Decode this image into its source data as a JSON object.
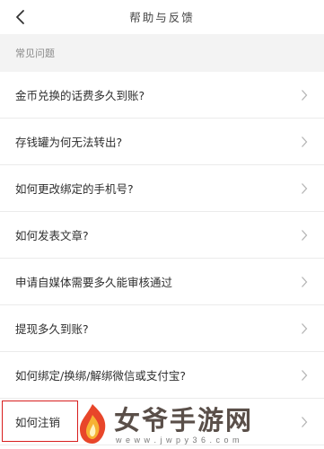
{
  "nav": {
    "title": "帮助与反馈",
    "back_icon": "chevron-left-icon"
  },
  "section": {
    "title": "常见问题"
  },
  "faq_items": [
    {
      "label": "金币兑换的话费多久到账?"
    },
    {
      "label": "存钱罐为何无法转出?"
    },
    {
      "label": "如何更改绑定的手机号?"
    },
    {
      "label": "如何发表文章?"
    },
    {
      "label": "申请自媒体需要多久能审核通过"
    },
    {
      "label": "提现多久到账?"
    },
    {
      "label": "如何绑定/换绑/解绑微信或支付宝?"
    },
    {
      "label": "如何注销"
    }
  ],
  "watermark": {
    "title": "女爷手游网",
    "url": "w e w w . j w p y 3 6 . c o m"
  },
  "colors": {
    "background": "#ffffff",
    "section_bg": "#f3f3f3",
    "divider": "#ebebeb",
    "highlight_border": "#d81e1e"
  }
}
